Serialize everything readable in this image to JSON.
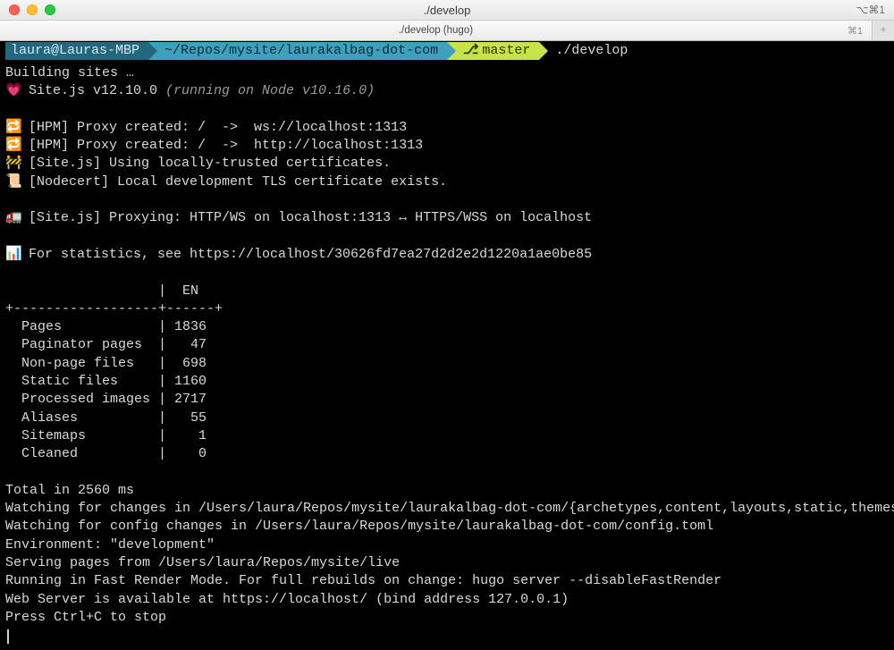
{
  "window": {
    "title": "./develop",
    "right_shortcut": "⌥⌘1"
  },
  "tab": {
    "label": "./develop (hugo)",
    "shortcut": "⌘1",
    "add_symbol": "+"
  },
  "prompt": {
    "user": "laura@Lauras-MBP",
    "path": "~/Repos/mysite/laurakalbag-dot-com",
    "branch_icon": "⎇",
    "branch": "master",
    "command": "./develop"
  },
  "out": {
    "building": "Building sites …",
    "e_heart": "💗",
    "sitejs": "Site.js v12.10.0 ",
    "sitejs_paren": "(running on Node v10.16.0)",
    "e_loop": "🔁",
    "proxy1": "[HPM] Proxy created: /  ->  ws://localhost:1313",
    "proxy2": "[HPM] Proxy created: /  ->  http://localhost:1313",
    "e_const": "🚧",
    "cert_use": "[Site.js] Using locally-trusted certificates.",
    "e_scroll": "📜",
    "cert_exist": "[Nodecert] Local development TLS certificate exists.",
    "e_truck": "🚛",
    "proxying": "[Site.js] Proxying: HTTP/WS on localhost:1313 ↔ HTTPS/WSS on localhost",
    "e_chart": "📊",
    "stats": "For statistics, see https://localhost/30626fd7ea27d2d2e2d1220a1ae0be85",
    "table": "                   |  EN   \n+------------------+------+\n  Pages            | 1836  \n  Paginator pages  |   47  \n  Non-page files   |  698  \n  Static files     | 1160  \n  Processed images | 2717  \n  Aliases          |   55  \n  Sitemaps         |    1  \n  Cleaned          |    0  ",
    "total": "Total in 2560 ms",
    "watch1": "Watching for changes in /Users/laura/Repos/mysite/laurakalbag-dot-com/{archetypes,content,layouts,static,themes}",
    "watch2": "Watching for config changes in /Users/laura/Repos/mysite/laurakalbag-dot-com/config.toml",
    "env": "Environment: \"development\"",
    "serving": "Serving pages from /Users/laura/Repos/mysite/live",
    "fast": "Running in Fast Render Mode. For full rebuilds on change: hugo server --disableFastRender",
    "web": "Web Server is available at https://localhost/ (bind address 127.0.0.1)",
    "stop": "Press Ctrl+C to stop"
  }
}
